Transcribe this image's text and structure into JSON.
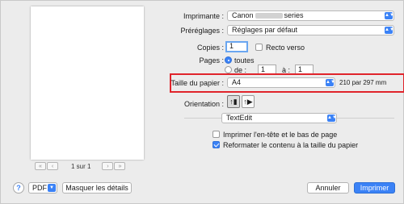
{
  "preview": {
    "page_indicator": "1 sur 1",
    "first_icon": "«",
    "prev_icon": "‹",
    "next_icon": "›",
    "last_icon": "»"
  },
  "printer": {
    "label": "Imprimante :",
    "value_prefix": "Canon",
    "value_suffix": "series"
  },
  "presets": {
    "label": "Préréglages :",
    "value": "Réglages par défaut"
  },
  "copies": {
    "label": "Copies :",
    "value": "1",
    "duplex_label": "Recto verso"
  },
  "pages": {
    "label": "Pages :",
    "all_label": "toutes",
    "from_label": "de :",
    "from_value": "1",
    "to_label": "à :",
    "to_value": "1"
  },
  "paper_size": {
    "label": "Taille du papier :",
    "value": "A4",
    "dimensions": "210 par 297 mm"
  },
  "orientation": {
    "label": "Orientation :"
  },
  "app_menu": {
    "value": "TextEdit"
  },
  "options": {
    "header_footer_label": "Imprimer l'en-tête et le bas de page",
    "reformat_label": "Reformater le contenu à la taille du papier"
  },
  "footer": {
    "help": "?",
    "pdf_label": "PDF",
    "details_label": "Masquer les détails",
    "cancel_label": "Annuler",
    "print_label": "Imprimer"
  },
  "colors": {
    "accent": "#3b82f6",
    "highlight": "#e0242b"
  }
}
